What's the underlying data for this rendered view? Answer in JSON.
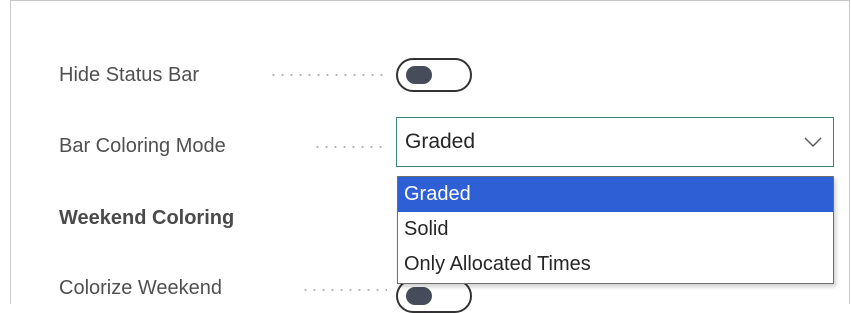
{
  "settings": {
    "hide_status_bar": {
      "label": "Hide Status Bar",
      "on": false
    },
    "bar_coloring_mode": {
      "label": "Bar Coloring Mode",
      "value": "Graded",
      "options": [
        "Graded",
        "Solid",
        "Only Allocated Times"
      ],
      "highlighted": "Graded"
    },
    "weekend_section": {
      "heading": "Weekend Coloring"
    },
    "colorize_weekend": {
      "label": "Colorize Weekend",
      "on": false
    }
  },
  "colors": {
    "select_border": "#38827a",
    "highlight": "#2f5fd4",
    "toggle_knob": "#464c5a"
  },
  "icons": {
    "select_chevron": "chevron-down-icon"
  }
}
